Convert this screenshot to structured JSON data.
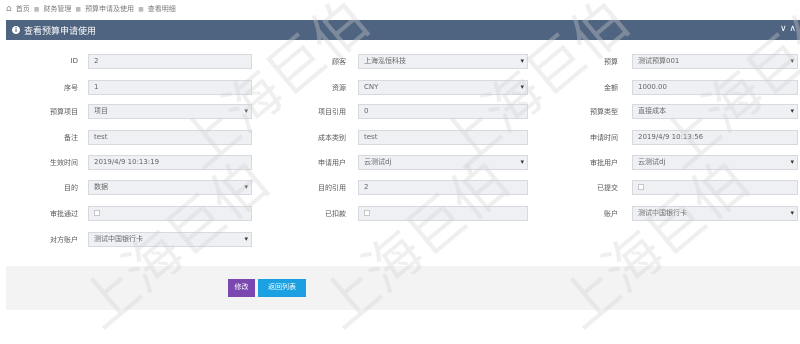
{
  "breadcrumb": [
    "首页",
    "财务管理",
    "预算申请及使用",
    "查看明细"
  ],
  "panel": {
    "title": "查看预算申请使用"
  },
  "fields": {
    "id": {
      "label": "ID",
      "value": "2"
    },
    "customer": {
      "label": "顾客",
      "value": "上海泓恒科技"
    },
    "budget": {
      "label": "预算",
      "value": "测试预算001"
    },
    "seq": {
      "label": "序号",
      "value": "1"
    },
    "resource": {
      "label": "资源",
      "value": "CNY"
    },
    "amount": {
      "label": "金额",
      "value": "1000.00"
    },
    "budget_item": {
      "label": "预算项目",
      "value": "项目"
    },
    "item_ref": {
      "label": "项目引用",
      "value": "0"
    },
    "budget_type": {
      "label": "预算类型",
      "value": "直接成本"
    },
    "remark": {
      "label": "备注",
      "value": "test"
    },
    "cost_type": {
      "label": "成本类别",
      "value": "test"
    },
    "apply_time": {
      "label": "申请时间",
      "value": "2019/4/9 10:13:56"
    },
    "effective_time": {
      "label": "生效时间",
      "value": "2019/4/9 10:13:19"
    },
    "apply_user": {
      "label": "申请用户",
      "value": "云测试dj"
    },
    "approve_user": {
      "label": "审批用户",
      "value": "云测试dj"
    },
    "purpose": {
      "label": "目的",
      "value": "数据"
    },
    "purpose_ref": {
      "label": "目的引用",
      "value": "2"
    },
    "submitted": {
      "label": "已提交"
    },
    "approved": {
      "label": "审批通过"
    },
    "deducted": {
      "label": "已扣款"
    },
    "account": {
      "label": "账户",
      "value": "测试中国银行卡"
    },
    "counter_account": {
      "label": "对方账户",
      "value": "测试中国银行卡"
    }
  },
  "buttons": {
    "edit": "修改",
    "back": "返回列表"
  },
  "watermark": "上海巨伯",
  "colors": {
    "header": "#4f6480",
    "edit": "#7a48b0",
    "back": "#1ba1e2",
    "field_bg": "#eef0f4"
  }
}
